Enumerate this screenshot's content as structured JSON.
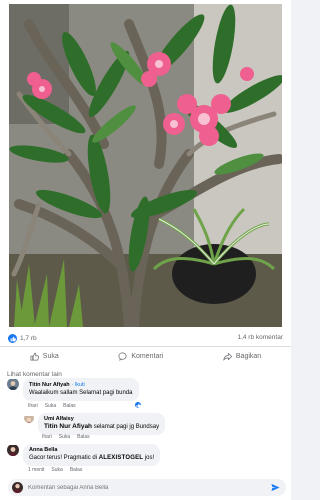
{
  "post": {
    "reactions_count": "1,7 rb",
    "comments_count": "1,4 rb komentar"
  },
  "actions": {
    "like": "Suka",
    "comment": "Komentari",
    "share": "Bagikan"
  },
  "comments_section": {
    "see_more": "Lihat komentar lain",
    "comments": [
      {
        "author": "Titin Nur Afiyah",
        "follow": "Ikuti",
        "text": "Waalaikum sallam Selamat pagi bunda",
        "time": "Ihari",
        "like": "Suka",
        "reply": "Balas"
      },
      {
        "author": "Umi Alfaisy",
        "mention": "Titin Nur Afiyah",
        "text": "selamat pagi jg Bundsay",
        "time": "Ihari",
        "like": "Suka",
        "reply": "Balas"
      },
      {
        "author": "Anna Bella",
        "text_prefix": "Gacor terus! Pragmatic di",
        "brand": "ALEXISTOGEL",
        "text_suffix": "jos!",
        "time": "1 menit",
        "like": "Suka",
        "reply": "Balas"
      }
    ],
    "compose_placeholder": "Komentari sebagai Anna Bella"
  },
  "icons": {
    "like_badge": "thumbs-up-icon",
    "like": "thumbs-up-outline-icon",
    "comment": "speech-bubble-icon",
    "share": "share-arrow-icon",
    "send": "send-icon"
  },
  "colors": {
    "accent": "#1877f2",
    "secondary_text": "#65676b",
    "bubble_bg": "#f0f2f5"
  }
}
